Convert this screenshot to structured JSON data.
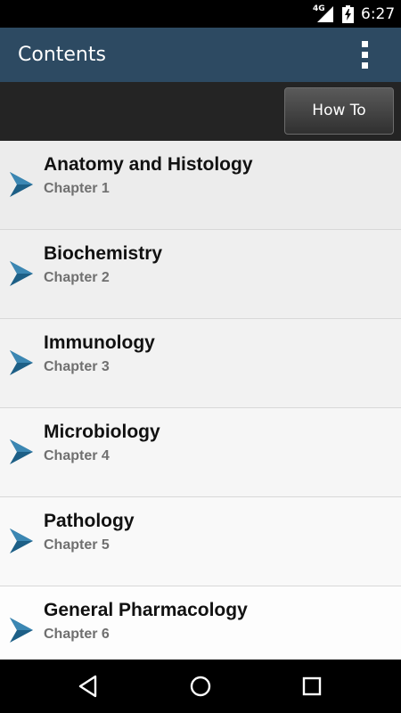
{
  "status_bar": {
    "network": "4G",
    "time": "6:27",
    "icons": [
      "signal-icon",
      "battery-charging-icon"
    ]
  },
  "action_bar": {
    "title": "Contents",
    "overflow_icon": "overflow-menu-icon"
  },
  "toolbar": {
    "howto_label": "How To"
  },
  "chapters": [
    {
      "title": "Anatomy and Histology",
      "subtitle": "Chapter 1"
    },
    {
      "title": "Biochemistry",
      "subtitle": "Chapter 2"
    },
    {
      "title": "Immunology",
      "subtitle": "Chapter 3"
    },
    {
      "title": "Microbiology",
      "subtitle": "Chapter 4"
    },
    {
      "title": "Pathology",
      "subtitle": "Chapter 5"
    },
    {
      "title": "General Pharmacology",
      "subtitle": "Chapter 6"
    }
  ],
  "nav_bar": {
    "icons": [
      "back-icon",
      "home-icon",
      "recents-icon"
    ]
  },
  "colors": {
    "action_bar": "#2d4a62",
    "toolbar": "#242424",
    "arrow": "#1d5f86"
  }
}
